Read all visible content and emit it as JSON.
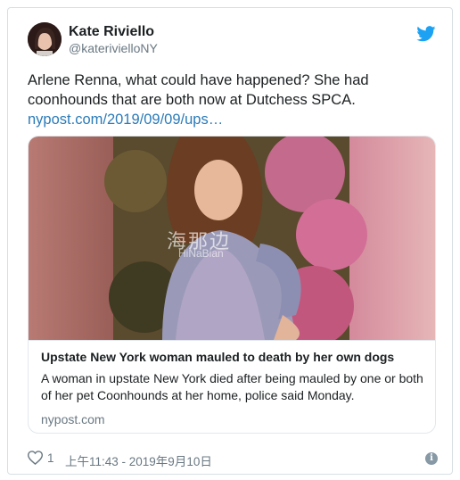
{
  "user": {
    "name": "Kate Riviello",
    "handle": "@katerivielloNY"
  },
  "tweet": {
    "text": "Arlene Renna, what could have happened? She had coonhounds that are both now at Dutchess SPCA.",
    "link": "nypost.com/2019/09/09/ups…"
  },
  "card": {
    "image_watermark_cn": "海那边",
    "image_watermark_en": "HiNaBian",
    "title": "Upstate New York woman mauled to death by her own dogs",
    "description": "A woman in upstate New York died after being mauled by one or both of her pet Coonhounds at her home, police said Monday.",
    "domain": "nypost.com"
  },
  "footer": {
    "like_count": "1",
    "timestamp": "上午11:43 - 2019年9月10日"
  },
  "icons": {
    "brand": "twitter-bird-icon",
    "like": "heart-icon",
    "info": "info-icon"
  },
  "colors": {
    "link": "#2b7bb9",
    "twitter_blue": "#1da1f2",
    "muted": "#697882"
  }
}
